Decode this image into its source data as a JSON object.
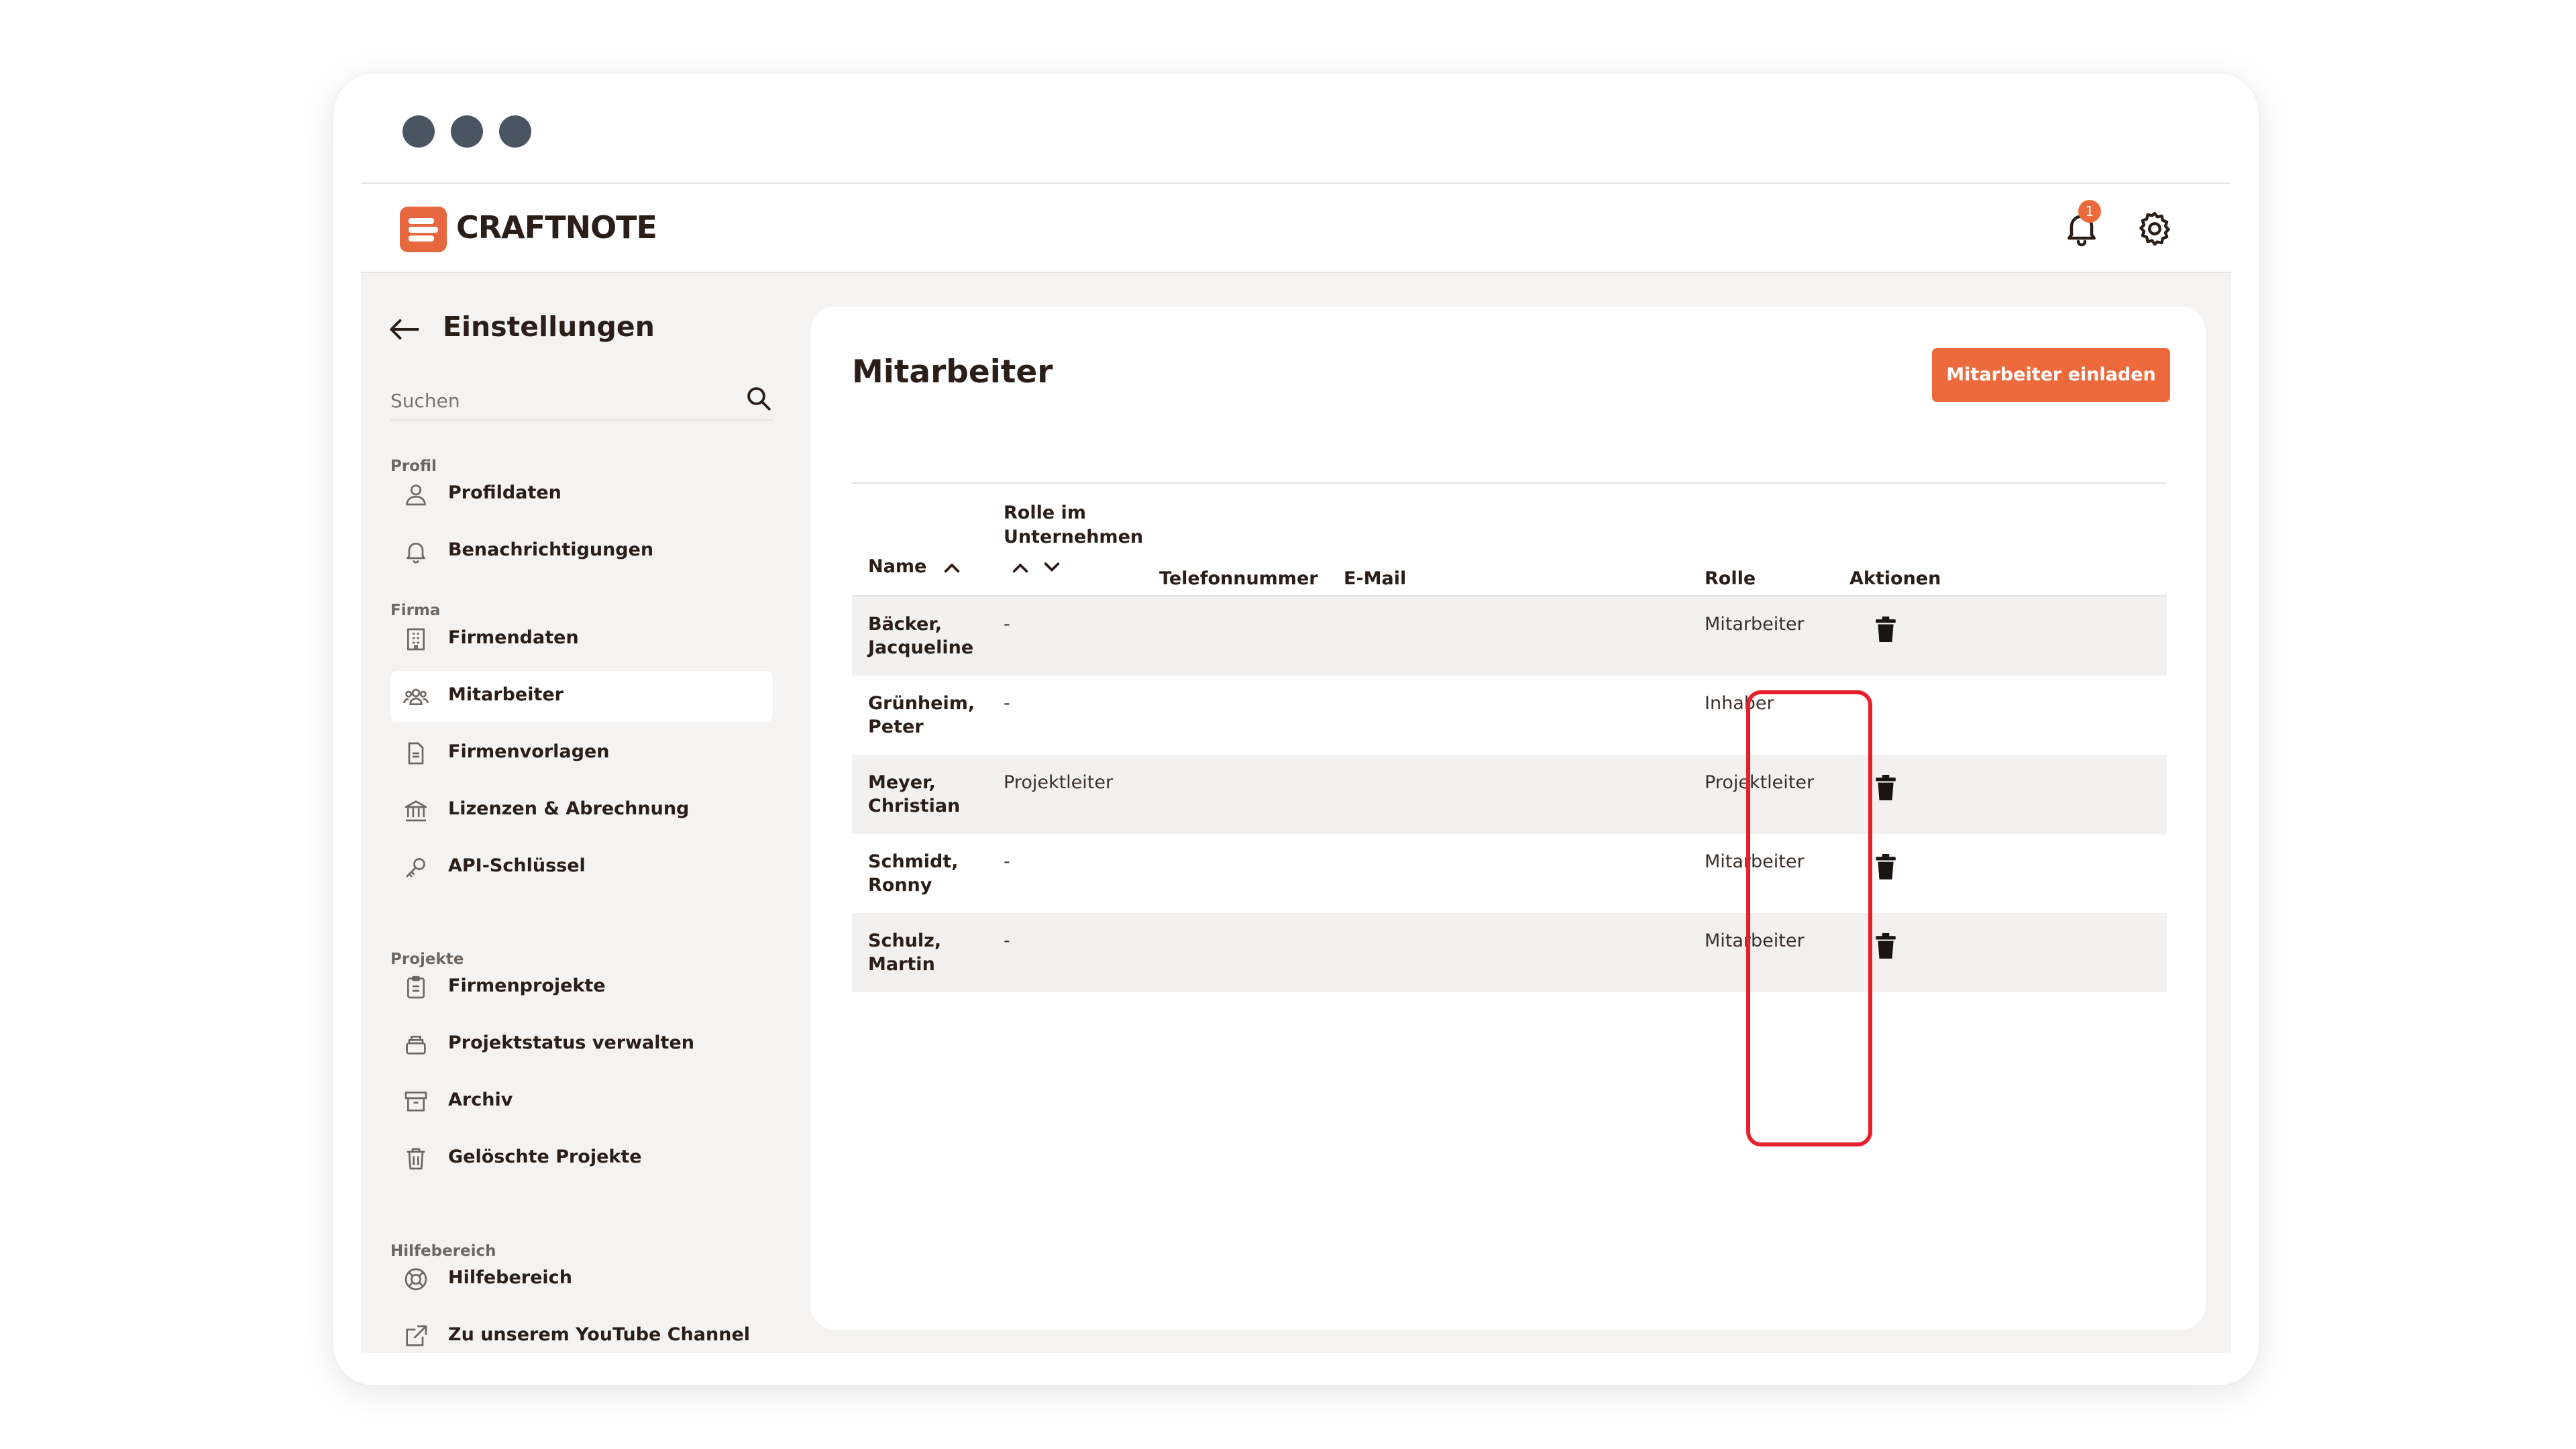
{
  "app": {
    "brand": "CRAFTNOTE",
    "notification_count": "1"
  },
  "sidebar": {
    "title": "Einstellungen",
    "search_placeholder": "Suchen",
    "sections": {
      "profil": "Profil",
      "firma": "Firma",
      "projekte": "Projekte",
      "hilfe": "Hilfebereich"
    },
    "items": [
      {
        "label": "Profildaten",
        "icon": "user-icon"
      },
      {
        "label": "Benachrichtigungen",
        "icon": "bell-icon"
      },
      {
        "label": "Firmendaten",
        "icon": "building-icon"
      },
      {
        "label": "Mitarbeiter",
        "icon": "users-icon",
        "active": true
      },
      {
        "label": "Firmenvorlagen",
        "icon": "document-icon"
      },
      {
        "label": "Lizenzen & Abrechnung",
        "icon": "bank-icon"
      },
      {
        "label": "API-Schlüssel",
        "icon": "key-icon"
      },
      {
        "label": "Firmenprojekte",
        "icon": "clipboard-icon"
      },
      {
        "label": "Projektstatus verwalten",
        "icon": "layers-icon"
      },
      {
        "label": "Archiv",
        "icon": "archive-icon"
      },
      {
        "label": "Gelöschte Projekte",
        "icon": "trash-icon"
      },
      {
        "label": "Hilfebereich",
        "icon": "lifebuoy-icon"
      },
      {
        "label": "Zu unserem YouTube Channel",
        "icon": "external-link-icon"
      }
    ]
  },
  "main": {
    "title": "Mitarbeiter",
    "invite_button": "Mitarbeiter einladen",
    "columns": {
      "name": "Name",
      "rolle_unternehmen": "Rolle im Unternehmen",
      "telefon": "Telefonnummer",
      "email": "E-Mail",
      "rolle": "Rolle",
      "aktionen": "Aktionen"
    },
    "rows": [
      {
        "name": "Bäcker, Jacqueline",
        "rolle_unternehmen": "-",
        "telefon": "",
        "email": "",
        "rolle": "Mitarbeiter",
        "deletable": true
      },
      {
        "name": "Grünheim, Peter",
        "rolle_unternehmen": "-",
        "telefon": "",
        "email": "",
        "rolle": "Inhaber",
        "deletable": false
      },
      {
        "name": "Meyer, Christian",
        "rolle_unternehmen": "Projektleiter",
        "telefon": "",
        "email": "",
        "rolle": "Projektleiter",
        "deletable": true
      },
      {
        "name": "Schmidt, Ronny",
        "rolle_unternehmen": "-",
        "telefon": "",
        "email": "",
        "rolle": "Mitarbeiter",
        "deletable": true
      },
      {
        "name": "Schulz, Martin",
        "rolle_unternehmen": "-",
        "telefon": "",
        "email": "",
        "rolle": "Mitarbeiter",
        "deletable": true
      }
    ]
  },
  "colors": {
    "accent": "#ec6a3c",
    "highlight": "#e4202b",
    "text": "#2b1d17"
  }
}
